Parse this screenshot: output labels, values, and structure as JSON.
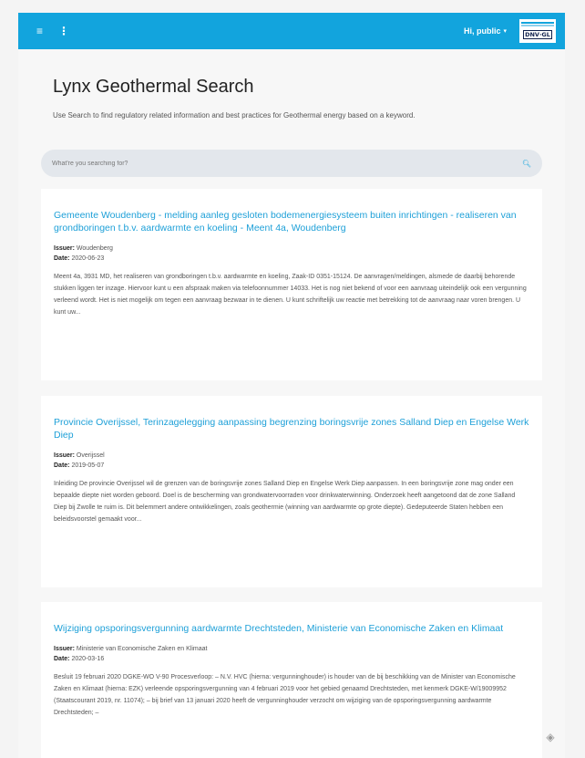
{
  "topbar": {
    "menu_icon": "hamburger-menu-icon",
    "more_icon": "vertical-dots-icon",
    "user_label": "Hi, public",
    "caret": "▾",
    "logo_text": "DNV·GL",
    "brand_color": "#12a4dd"
  },
  "page": {
    "title": "Lynx Geothermal Search",
    "subtitle": "Use Search to find regulatory related information and best practices for Geothermal energy based on a keyword."
  },
  "search": {
    "placeholder": "What're you searching for?",
    "icon": "search-icon"
  },
  "results": [
    {
      "title": "Gemeente Woudenberg - melding aanleg gesloten bodemenergiesysteem buiten inrichtingen - realiseren van grondboringen t.b.v. aardwarmte en koeling - Meent 4a, Woudenberg",
      "issuer_label": "Issuer:",
      "issuer": "Woudenberg",
      "date_label": "Date:",
      "date": "2020-06-23",
      "excerpt": "Meent 4a, 3931 MD, het realiseren van grondboringen t.b.v. aardwarmte en koeling, Zaak-ID 0351-15124. De aanvragen/meldingen, alsmede de daarbij behorende stukken liggen ter inzage. Hiervoor kunt u een afspraak maken via telefoonnummer 14033. Het is nog niet bekend of voor een aanvraag uiteindelijk ook een vergunning verleend wordt. Het is niet mogelijk om tegen een aanvraag bezwaar in te dienen. U kunt schriftelijk uw reactie met betrekking tot de aanvraag naar voren brengen. U kunt uw..."
    },
    {
      "title": "Provincie Overijssel, Terinzagelegging aanpassing begrenzing boringsvrije zones Salland Diep en Engelse Werk Diep",
      "issuer_label": "Issuer:",
      "issuer": "Overijssel",
      "date_label": "Date:",
      "date": "2019-05-07",
      "excerpt": "Inleiding De provincie Overijssel wil de grenzen van de boringsvrije zones Salland Diep en Engelse Werk Diep aanpassen. In een boringsvrije zone mag onder een bepaalde diepte niet worden geboord. Doel is de bescherming van grondwatervoorraden voor drinkwaterwinning. Onderzoek heeft aangetoond dat de zone Salland Diep bij Zwolle te ruim is. Dit belemmert andere ontwikkelingen, zoals geothermie (winning van aardwarmte op grote diepte). Gedeputeerde Staten hebben een beleidsvoorstel gemaakt voor..."
    },
    {
      "title": "Wijziging opsporingsvergunning aardwarmte Drechtsteden, Ministerie van Economische Zaken en Klimaat",
      "issuer_label": "Issuer:",
      "issuer": "Ministerie van Economische Zaken en Klimaat",
      "date_label": "Date:",
      "date": "2020-03-16",
      "excerpt": "Besluit 19 februari 2020 DGKE-WO V-90 Procesverloop: – N.V. HVC (hierna: vergunninghouder) is houder van de bij beschikking van de Minister van Economische Zaken en Klimaat (hierna: EZK) verleende opsporingsvergunning van 4 februari 2019 voor het gebied genaamd Drechtsteden, met kenmerk DGKE-W/19009952 (Staatscourant 2019, nr. 11074); – bij brief van 13 januari 2020 heeft de vergunninghouder verzocht om wijziging van de opsporingsvergunning aardwarmte Drechtsteden; –"
    }
  ],
  "fab_icon": "diamond-nav-icon"
}
